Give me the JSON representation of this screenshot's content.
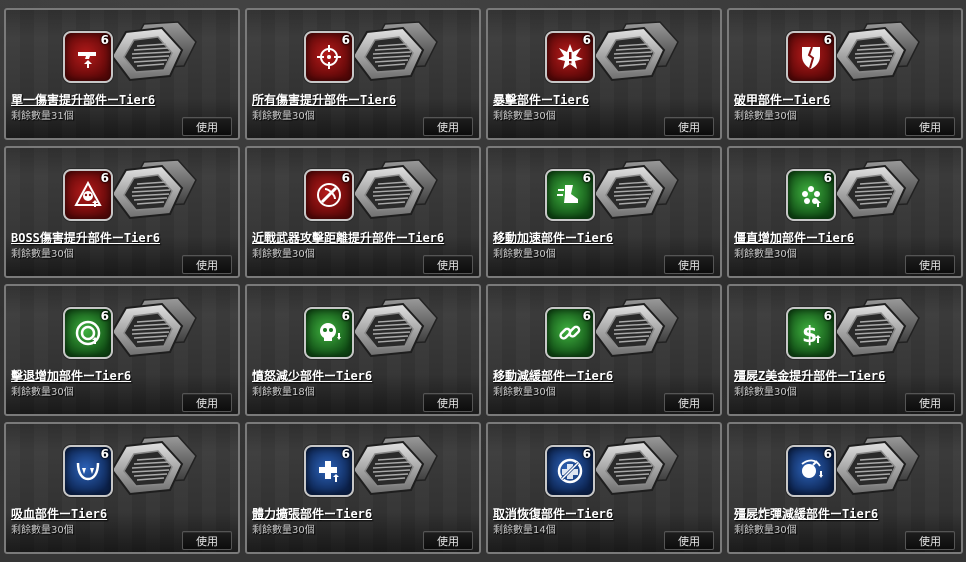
{
  "use_label": "使用",
  "colors": {
    "red": "#8a1010",
    "green": "#1e7a24",
    "blue": "#183c7e",
    "card_border": "#7a7a7a"
  },
  "items": [
    {
      "name": "單一傷害提升部件ーTier6",
      "count": "剩餘數量31個",
      "tier": "6",
      "color": "red",
      "icon": "gun-up-icon"
    },
    {
      "name": "所有傷害提升部件ーTier6",
      "count": "剩餘數量30個",
      "tier": "6",
      "color": "red",
      "icon": "crosshair-up-icon"
    },
    {
      "name": "暴擊部件ーTier6",
      "count": "剩餘數量30個",
      "tier": "6",
      "color": "red",
      "icon": "critical-burst-icon"
    },
    {
      "name": "破甲部件ーTier6",
      "count": "剩餘數量30個",
      "tier": "6",
      "color": "red",
      "icon": "broken-shield-icon"
    },
    {
      "name": "BOSS傷害提升部件ーTier6",
      "count": "剩餘數量30個",
      "tier": "6",
      "color": "red",
      "icon": "boss-skull-up-icon"
    },
    {
      "name": "近戰武器攻擊距離提升部件ーTier6",
      "count": "剩餘數量30個",
      "tier": "6",
      "color": "red",
      "icon": "melee-range-icon"
    },
    {
      "name": "移動加速部件ーTier6",
      "count": "剩餘數量30個",
      "tier": "6",
      "color": "green",
      "icon": "speed-boot-icon"
    },
    {
      "name": "僵直增加部件ーTier6",
      "count": "剩餘數量30個",
      "tier": "6",
      "color": "green",
      "icon": "stun-burst-icon"
    },
    {
      "name": "擊退增加部件ーTier6",
      "count": "剩餘數量30個",
      "tier": "6",
      "color": "green",
      "icon": "knockback-ring-icon"
    },
    {
      "name": "憤怒減少部件ーTier6",
      "count": "剩餘數量18個",
      "tier": "6",
      "color": "green",
      "icon": "rage-skull-down-icon"
    },
    {
      "name": "移動減緩部件ーTier6",
      "count": "剩餘數量30個",
      "tier": "6",
      "color": "green",
      "icon": "chain-link-icon"
    },
    {
      "name": "殭屍Z美金提升部件ーTier6",
      "count": "剩餘數量30個",
      "tier": "6",
      "color": "green",
      "icon": "dollar-up-icon"
    },
    {
      "name": "吸血部件ーTier6",
      "count": "剩餘數量30個",
      "tier": "6",
      "color": "blue",
      "icon": "fangs-icon"
    },
    {
      "name": "體力擴張部件ーTier6",
      "count": "剩餘數量30個",
      "tier": "6",
      "color": "blue",
      "icon": "health-cross-up-icon"
    },
    {
      "name": "取消恢復部件ーTier6",
      "count": "剩餘數量14個",
      "tier": "6",
      "color": "blue",
      "icon": "no-heal-icon"
    },
    {
      "name": "殭屍炸彈減緩部件ーTier6",
      "count": "剩餘數量30個",
      "tier": "6",
      "color": "blue",
      "icon": "bomb-slow-icon"
    }
  ]
}
